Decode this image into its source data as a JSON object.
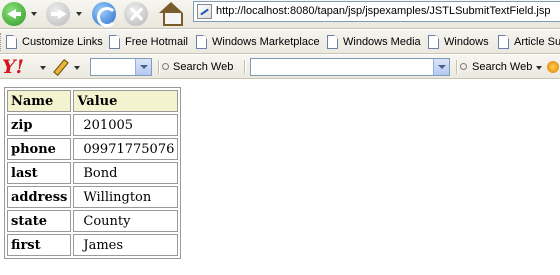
{
  "browser": {
    "address": "http://localhost:8080/tapan/jsp/jspexamples/JSTLSubmitTextField.jsp"
  },
  "links": [
    {
      "label": "Customize Links"
    },
    {
      "label": "Free Hotmail"
    },
    {
      "label": "Windows Marketplace"
    },
    {
      "label": "Windows Media"
    },
    {
      "label": "Windows"
    },
    {
      "label": "Article Su"
    }
  ],
  "yahoo_toolbar": {
    "logo": "Y!",
    "search_label_1": "Search Web",
    "search_label_2": "Search Web",
    "search_value": ""
  },
  "table": {
    "headers": [
      "Name",
      "Value"
    ],
    "rows": [
      {
        "name": "zip",
        "value": "201005"
      },
      {
        "name": "phone",
        "value": "09971775076"
      },
      {
        "name": "last",
        "value": "Bond"
      },
      {
        "name": "address",
        "value": "Willington"
      },
      {
        "name": "state",
        "value": "County"
      },
      {
        "name": "first",
        "value": "James"
      }
    ]
  },
  "colors": {
    "header_bg": "#f4f3cf",
    "yahoo_red": "#d4161e"
  },
  "icons": [
    "back-icon",
    "forward-icon",
    "refresh-icon",
    "stop-icon",
    "home-icon",
    "page-icon",
    "yahoo-logo",
    "pencil-icon",
    "magnifier-icon"
  ]
}
